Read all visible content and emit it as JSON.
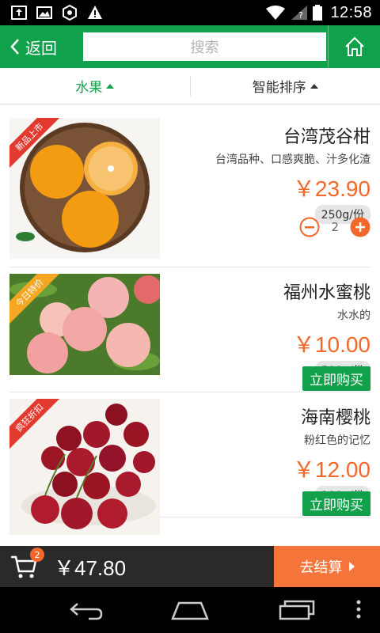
{
  "status_bar": {
    "time": "12:58",
    "left_icons": [
      "usb-upload-icon",
      "image-icon",
      "settings-hex-icon",
      "warning-icon"
    ],
    "right_icons": [
      "wifi-icon",
      "signal-icon",
      "battery-icon"
    ]
  },
  "header": {
    "back_label": "返回",
    "search_placeholder": "搜索",
    "home_icon": "home-icon",
    "bg_color": "#12a14b"
  },
  "filters": [
    {
      "label": "水果",
      "active": true
    },
    {
      "label": "智能排序",
      "active": false
    }
  ],
  "products": [
    {
      "name": "台湾茂谷柑",
      "desc": "台湾品种、口感爽脆、汁多化渣",
      "price": "￥23.90",
      "weight": "250g/份",
      "badge": "新品上市",
      "quantity": "2",
      "in_cart": true
    },
    {
      "name": "福州水蜜桃",
      "desc": "水水的",
      "price": "￥10.00",
      "weight": "500g/份",
      "badge": "今日特价",
      "buy_label": "立即购买",
      "in_cart": false
    },
    {
      "name": "海南樱桃",
      "desc": "粉红色的记忆",
      "price": "￥12.00",
      "weight": "100g/份",
      "badge": "疯狂折扣",
      "buy_label": "立即购买",
      "in_cart": false
    }
  ],
  "cart": {
    "count": "2",
    "total": "￥47.80",
    "checkout_label": "去结算",
    "accent_color": "#f5753a"
  },
  "nav": {
    "icons": [
      "back-nav-icon",
      "home-nav-icon",
      "recents-nav-icon",
      "menu-dots-icon"
    ]
  }
}
